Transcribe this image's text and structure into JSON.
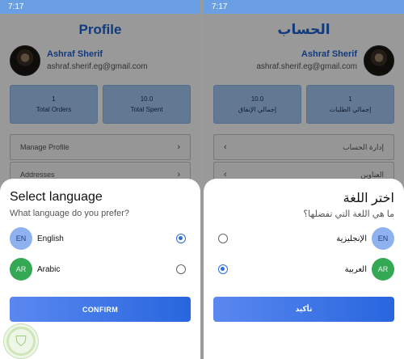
{
  "left": {
    "status_time": "7:17",
    "page_title": "Profile",
    "user": {
      "name": "Ashraf Sherif",
      "email": "ashraf.sherif.eg@gmail.com"
    },
    "stats": [
      {
        "value": "1",
        "label": "Total Orders"
      },
      {
        "value": "10.0",
        "label": "Total Spent"
      }
    ],
    "menu": [
      "Manage Profile",
      "Addresses"
    ],
    "sheet": {
      "title": "Select language",
      "subtitle": "What language do you prefer?",
      "options": [
        {
          "badge": "EN",
          "label": "English",
          "selected": true
        },
        {
          "badge": "AR",
          "label": "Arabic",
          "selected": false
        }
      ],
      "confirm": "CONFIRM"
    }
  },
  "right": {
    "status_time": "7:17",
    "page_title": "الحساب",
    "user": {
      "name": "Ashraf Sherif",
      "email": "ashraf.sherif.eg@gmail.com"
    },
    "stats": [
      {
        "value": "1",
        "label": "إجمالي الطلبات"
      },
      {
        "value": "10.0",
        "label": "إجمالي الإنفاق"
      }
    ],
    "menu": [
      "إدارة الحساب",
      "العناوين"
    ],
    "sheet": {
      "title": "اختر اللغة",
      "subtitle": "ما هي اللغة التي تفضلها؟",
      "options": [
        {
          "badge": "EN",
          "label": "الإنجليزية",
          "selected": false
        },
        {
          "badge": "AR",
          "label": "العربية",
          "selected": true
        }
      ],
      "confirm": "تأكيد"
    }
  },
  "colors": {
    "accent": "#2b6be0",
    "title_blue": "#1f63d1",
    "stat_card": "#a3c8f5",
    "arabic_badge": "#34a853",
    "english_badge": "#8fb2ee"
  }
}
